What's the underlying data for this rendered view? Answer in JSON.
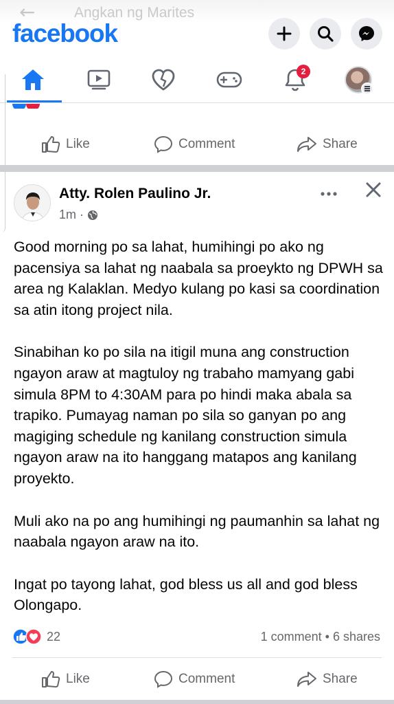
{
  "overlay": {
    "group_title": "Angkan ng Marites"
  },
  "header": {
    "logo": "facebook",
    "buttons": [
      "plus-icon",
      "search-icon",
      "messenger-icon"
    ]
  },
  "tabs": [
    {
      "name": "home",
      "icon": "home-icon",
      "active": true
    },
    {
      "name": "watch",
      "icon": "video-icon"
    },
    {
      "name": "dating",
      "icon": "heart-icon"
    },
    {
      "name": "gaming",
      "icon": "gamepad-icon"
    },
    {
      "name": "notifications",
      "icon": "bell-icon",
      "badge": "2"
    },
    {
      "name": "menu",
      "icon": "profile-icon"
    }
  ],
  "actions": {
    "like": "Like",
    "comment": "Comment",
    "share": "Share"
  },
  "post": {
    "author": "Atty. Rolen Paulino Jr.",
    "time": "1m",
    "dot": "·",
    "privacy_icon": "globe-icon",
    "paragraphs": [
      "Good morning po sa lahat, humihingi po ako ng pacensiya sa lahat ng naabala sa proeykto ng DPWH sa area ng Kalaklan. Medyo kulang po kasi sa coordination sa atin itong project nila.",
      "Sinabihan ko po sila na itigil muna ang construction ngayon araw at magtuloy ng trabaho mamyang gabi simula 8PM to 4:30AM para po hindi maka abala sa trapiko. Pumayag naman po sila so ganyan po ang magiging schedule ng kanilang construction simula ngayon araw na ito hanggang matapos ang kanilang proyekto.",
      "Muli ako na po ang humihingi ng paumanhin sa lahat ng naabala ngayon araw na ito.",
      "Ingat po tayong lahat, god bless us all and god bless Olongapo."
    ],
    "reaction_count": "22",
    "engagement": "1 comment • 6 shares"
  },
  "colors": {
    "brand": "#1877f2",
    "badge": "#e41e3f",
    "muted": "#65676b",
    "separator": "#ced0d4"
  }
}
